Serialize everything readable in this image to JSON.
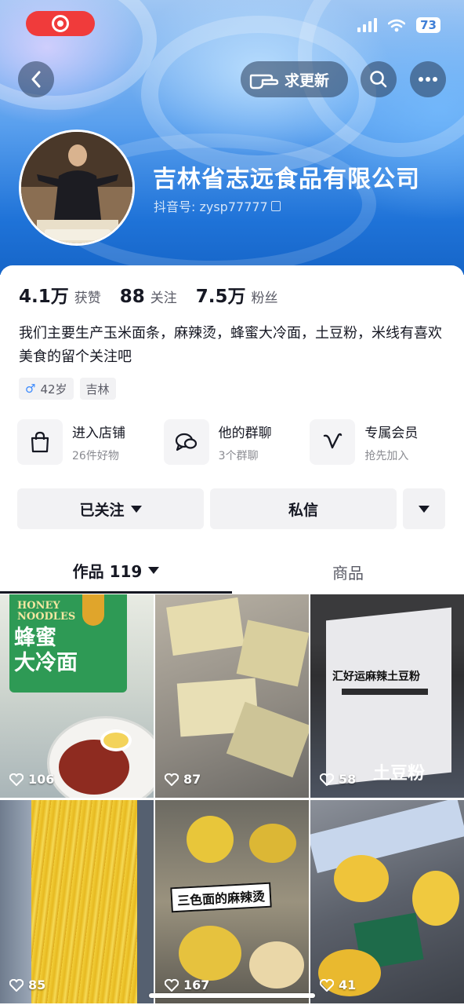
{
  "status_bar": {
    "battery": "73"
  },
  "nav": {
    "update_label": "求更新"
  },
  "profile": {
    "name": "吉林省志远食品有限公司",
    "douyin_id": "抖音号: zysp77777",
    "stats": [
      {
        "value": "4.1万",
        "label": "获赞"
      },
      {
        "value": "88",
        "label": "关注"
      },
      {
        "value": "7.5万",
        "label": "粉丝"
      }
    ],
    "bio": "我们主要生产玉米面条，麻辣烫，蜂蜜大冷面，土豆粉，米线有喜欢美食的留个关注吧",
    "tags": [
      {
        "symbol": "♂",
        "text": "42岁"
      },
      {
        "text": "吉林"
      }
    ]
  },
  "shortcuts": [
    {
      "title": "进入店铺",
      "sub": "26件好物",
      "icon": "shopping-bag-icon"
    },
    {
      "title": "他的群聊",
      "sub": "3个群聊",
      "icon": "group-chat-icon"
    },
    {
      "title": "专属会员",
      "sub": "抢先加入",
      "icon": "member-v-icon"
    }
  ],
  "actions": {
    "follow": "已关注",
    "message": "私信"
  },
  "tabs": [
    {
      "label": "作品 119"
    },
    {
      "label": "商品"
    }
  ],
  "videos": [
    {
      "likes": "106",
      "overlay": [
        "HONEY",
        "NOODLES",
        "蜂蜜",
        "大冷面"
      ]
    },
    {
      "likes": "87"
    },
    {
      "likes": "58",
      "caption": "汇好运麻辣土豆粉",
      "overlay2": "土豆粉"
    },
    {
      "likes": "85"
    },
    {
      "likes": "167",
      "caption": "三色面的麻辣烫"
    },
    {
      "likes": "41"
    }
  ]
}
